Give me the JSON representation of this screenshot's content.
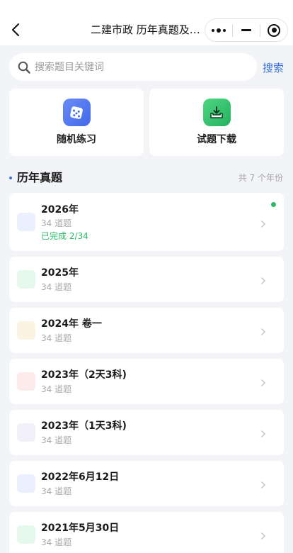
{
  "header": {
    "title": "二建市政 历年真题及解..."
  },
  "search": {
    "placeholder": "搜索题目关键词",
    "button_label": "搜索"
  },
  "quick_actions": [
    {
      "label": "随机练习",
      "icon": "dice-icon",
      "color": "#4a74ee"
    },
    {
      "label": "试题下载",
      "icon": "download-tray-icon",
      "color": "#2ec46b"
    }
  ],
  "section": {
    "title": "历年真题",
    "count_text": "共 7 个年份"
  },
  "years": [
    {
      "title": "2026年",
      "subtitle": "34 道题",
      "progress": "已完成 2/34",
      "icon_color": "#eaf0fd",
      "has_status_dot": true
    },
    {
      "title": "2025年",
      "subtitle": "34 道题",
      "icon_color": "#e6f7ec"
    },
    {
      "title": "2024年 卷一",
      "subtitle": "34 道题",
      "icon_color": "#fdf3e3"
    },
    {
      "title": "2023年（2天3科)",
      "subtitle": "34 道题",
      "icon_color": "#fdeaea"
    },
    {
      "title": "2023年（1天3科)",
      "subtitle": "34 道题",
      "icon_color": "#f1effa"
    },
    {
      "title": "2022年6月12日",
      "subtitle": "34 道题",
      "icon_color": "#eaf0fd"
    },
    {
      "title": "2021年5月30日",
      "subtitle": "34 道题",
      "icon_color": "#e6f7ec"
    }
  ],
  "colors": {
    "accent": "#3b6fd9",
    "success": "#2cb866",
    "background": "#f3f4f8"
  }
}
